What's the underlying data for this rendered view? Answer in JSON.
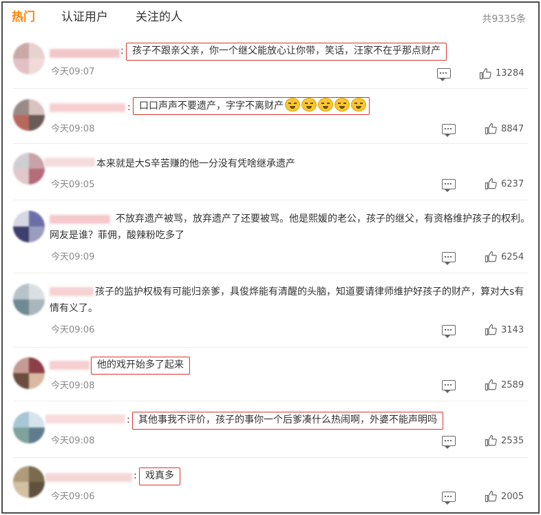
{
  "tabs": [
    {
      "label": "热门",
      "active": true
    },
    {
      "label": "认证用户",
      "active": false
    },
    {
      "label": "关注的人",
      "active": false
    }
  ],
  "total_count": "共9335条",
  "colors": {
    "active_tab": "#ff8200",
    "highlight_box": "#d9342b",
    "meta_text": "#888888"
  },
  "icons": {
    "reply": "comment-icon",
    "like": "thumbs-up-icon"
  },
  "comments": [
    {
      "text": "孩子不跟亲父亲，你一个继父能放心让你带，笑话，汪家不在乎那点财产",
      "time": "今天09:07",
      "likes": "13284"
    },
    {
      "text": "口口声声不要遗产，字字不离财产",
      "emoji": "laughing-crying-emoji",
      "time": "今天09:08",
      "likes": "8847"
    },
    {
      "text": "本来就是大S辛苦赚的他一分没有凭啥继承遗产",
      "time": "今天09:05",
      "likes": "6237"
    },
    {
      "text": "不放弃遗产被骂，放弃遗产了还要被骂。他是熙媛的老公，孩子的继父，有资格维护孩子的权利。网友是谁？菲佣，酸辣粉吃多了",
      "time": "今天09:09",
      "likes": "6254"
    },
    {
      "text": "孩子的监护权极有可能归亲爹，具俊烨能有清醒的头脑，知道要请律师维护好孩子的财产，算对大s有情有义了。",
      "time": "今天09:06",
      "likes": "3143"
    },
    {
      "text": "他的戏开始多了起来",
      "time": "今天09:08",
      "likes": "2589"
    },
    {
      "text": "其他事我不评价，孩子的事你一个后爹凑什么热闹啊，外婆不能声明吗",
      "time": "今天09:08",
      "likes": "2535"
    },
    {
      "text": "戏真多",
      "time": "今天09:06",
      "likes": "2005"
    }
  ]
}
